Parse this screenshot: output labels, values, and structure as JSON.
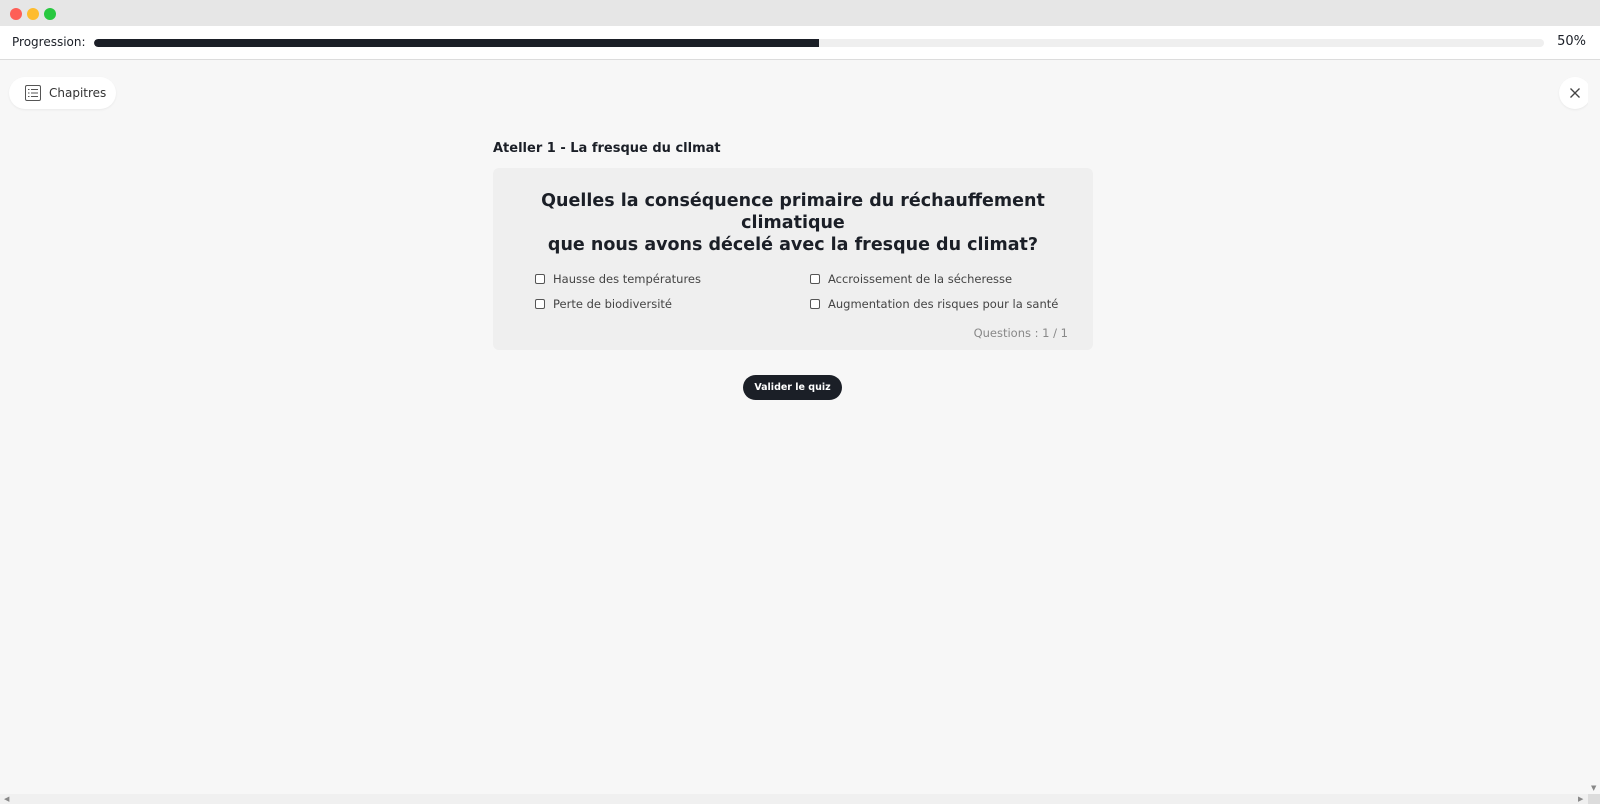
{
  "progress": {
    "label": "Progression:",
    "value_percent": 50,
    "percent_text": "50%"
  },
  "nav": {
    "chapters_label": "Chapitres"
  },
  "quiz": {
    "workshop_title": "Ateller 1 - La fresque du cllmat",
    "question_line1": "Quelles la conséquence primaire du réchauffement climatique",
    "question_line2": "que nous avons décelé avec la fresque du climat?",
    "options": [
      "Hausse des températures",
      "Accroissement de la sécheresse",
      "Perte de biodiversité",
      "Augmentation des risques pour la santé"
    ],
    "question_count": "Questions : 1 / 1",
    "validate_label": "Valider le quiz"
  },
  "colors": {
    "accent": "#1b1f27",
    "background": "#f7f7f7",
    "card": "#efefef"
  }
}
